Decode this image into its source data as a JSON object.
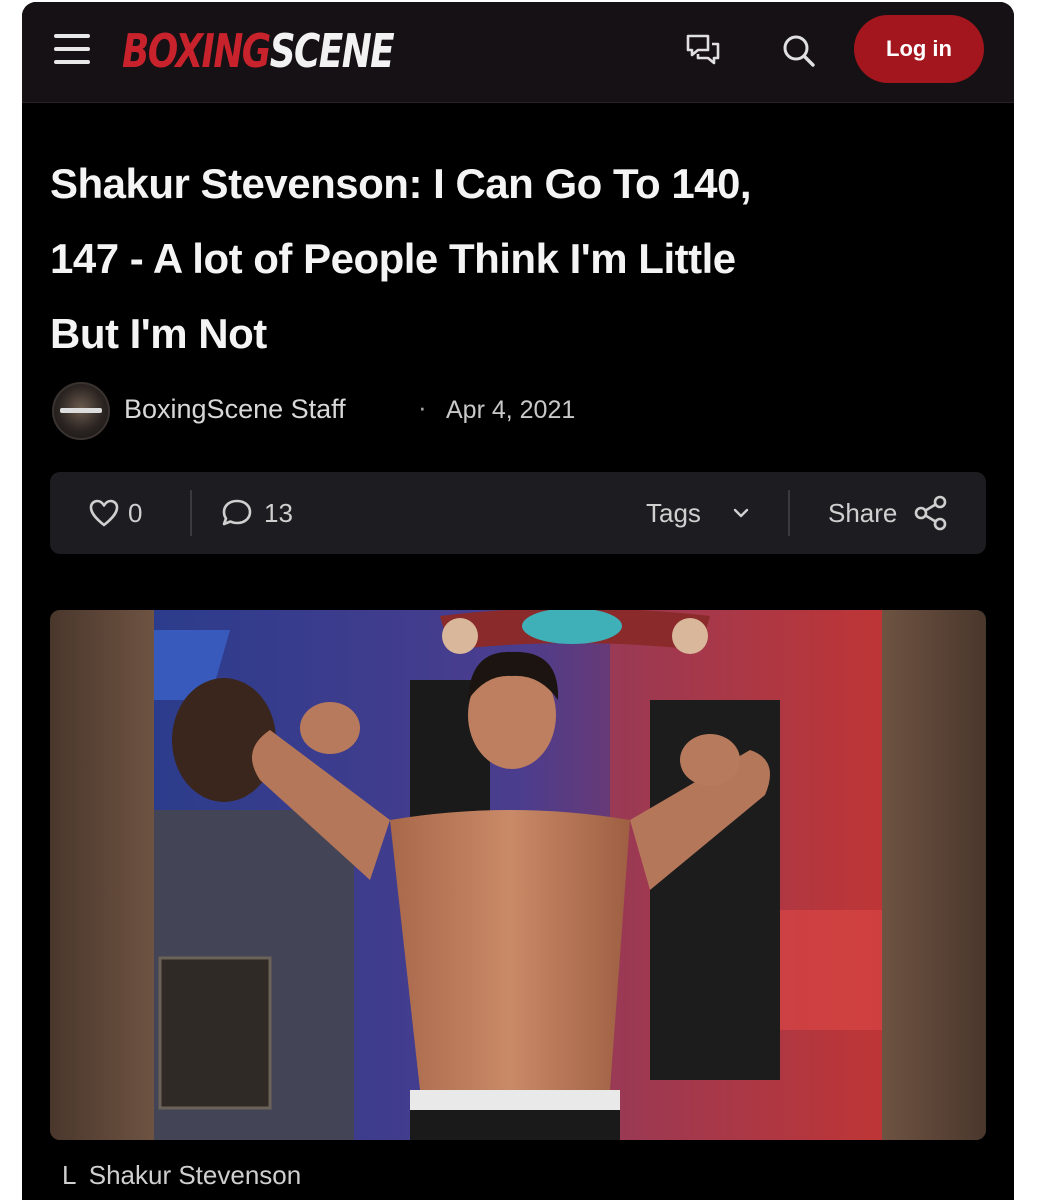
{
  "header": {
    "logo_part1": "BOXING",
    "logo_part2": "SCENE",
    "login_label": "Log in",
    "icons": [
      "menu-icon",
      "chat-icon",
      "search-icon"
    ]
  },
  "article": {
    "title_lines": [
      "Shakur Stevenson: I Can Go To 140,",
      "147 - A lot of People Think I'm Little",
      "But I'm Not"
    ],
    "author": "BoxingScene Staff",
    "separator": "·",
    "date": "Apr 4, 2021"
  },
  "actions": {
    "likes": "0",
    "comments": "13",
    "tags_label": "Tags",
    "share_label": "Share"
  },
  "photo": {
    "caption_prefix": "L",
    "caption": "Shakur Stevenson"
  },
  "colors": {
    "brand_red": "#c8232c",
    "login_bg": "#a3161d",
    "background": "#000000",
    "actionbar_bg": "#1d1d21"
  }
}
